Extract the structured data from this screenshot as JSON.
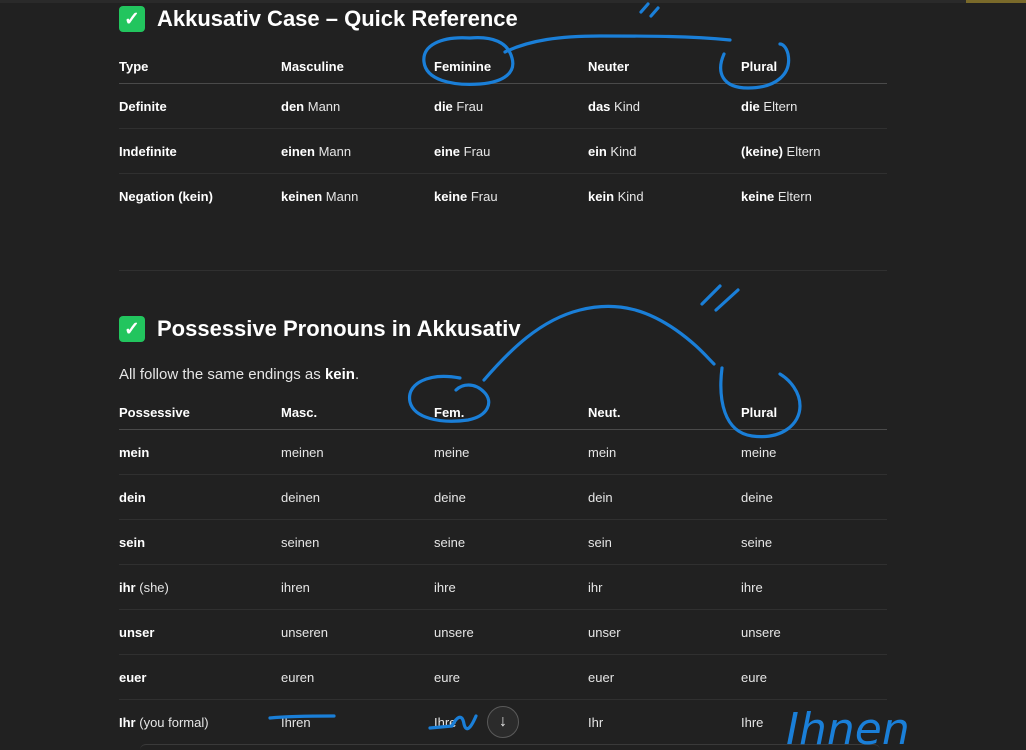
{
  "section1": {
    "title": "Akkusativ Case – Quick Reference",
    "icon": "check-mark-icon",
    "headers": [
      "Type",
      "Masculine",
      "Feminine",
      "Neuter",
      "Plural"
    ],
    "rows": [
      {
        "type": "Definite",
        "masc_bold": "den",
        "masc": " Mann",
        "fem_bold": "die",
        "fem": " Frau",
        "neut_bold": "das",
        "neut": " Kind",
        "plural_bold": "die",
        "plural": " Eltern"
      },
      {
        "type": "Indefinite",
        "masc_bold": "einen",
        "masc": " Mann",
        "fem_bold": "eine",
        "fem": " Frau",
        "neut_bold": "ein",
        "neut": " Kind",
        "plural_bold": "(keine)",
        "plural": " Eltern"
      },
      {
        "type": "Negation (kein)",
        "masc_bold": "keinen",
        "masc": " Mann",
        "fem_bold": "keine",
        "fem": " Frau",
        "neut_bold": "kein",
        "neut": " Kind",
        "plural_bold": "keine",
        "plural": " Eltern"
      }
    ]
  },
  "section2": {
    "title": "Possessive Pronouns in Akkusativ",
    "icon": "check-mark-icon",
    "intro_prefix": "All follow the same endings as ",
    "intro_bold": "kein",
    "intro_suffix": ".",
    "headers": [
      "Possessive",
      "Masc.",
      "Fem.",
      "Neut.",
      "Plural"
    ],
    "rows": [
      {
        "poss_bold": "mein",
        "poss": "",
        "masc": "meinen",
        "fem": "meine",
        "neut": "mein",
        "plural": "meine"
      },
      {
        "poss_bold": "dein",
        "poss": "",
        "masc": "deinen",
        "fem": "deine",
        "neut": "dein",
        "plural": "deine"
      },
      {
        "poss_bold": "sein",
        "poss": "",
        "masc": "seinen",
        "fem": "seine",
        "neut": "sein",
        "plural": "seine"
      },
      {
        "poss_bold": "ihr",
        "poss": " (she)",
        "masc": "ihren",
        "fem": "ihre",
        "neut": "ihr",
        "plural": "ihre"
      },
      {
        "poss_bold": "unser",
        "poss": "",
        "masc": "unseren",
        "fem": "unsere",
        "neut": "unser",
        "plural": "unsere"
      },
      {
        "poss_bold": "euer",
        "poss": "",
        "masc": "euren",
        "fem": "eure",
        "neut": "euer",
        "plural": "eure"
      },
      {
        "poss_bold": "Ihr",
        "poss": " (you formal)",
        "masc": "Ihren",
        "fem": "Ihre",
        "neut": "Ihr",
        "plural": "Ihre"
      }
    ]
  },
  "scroll_button": {
    "icon": "arrow-down-icon",
    "glyph": "↓"
  },
  "annotations": {
    "handwritten_note": "Ihnen",
    "ink_color": "#1a7fd8"
  },
  "colors": {
    "background": "#212121",
    "check": "#22c55e"
  }
}
